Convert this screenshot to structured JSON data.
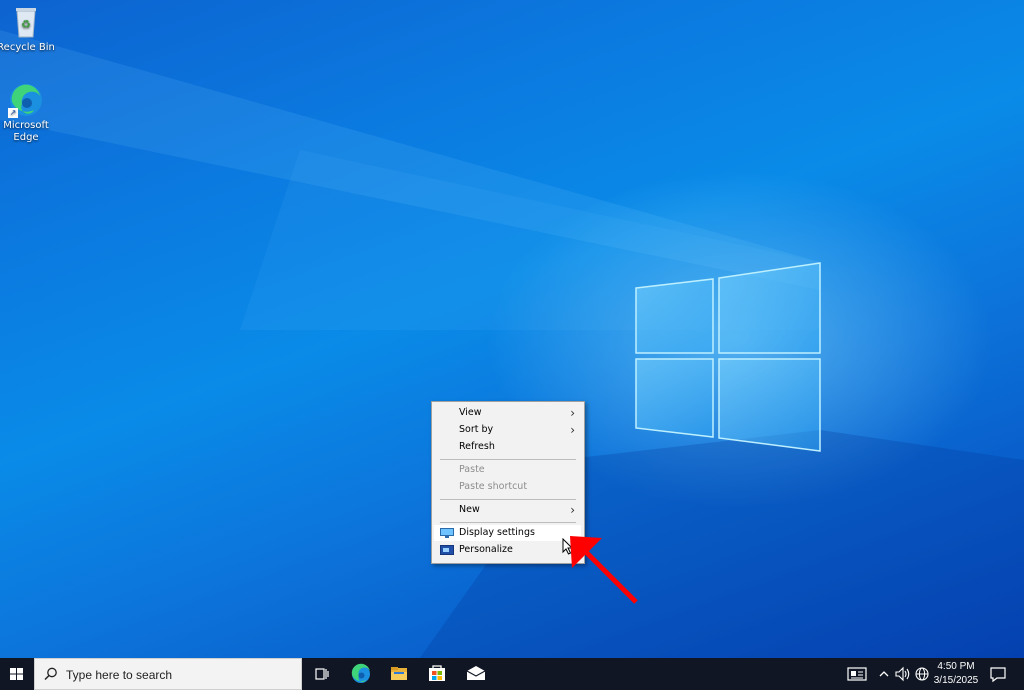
{
  "desktop": {
    "icons": [
      {
        "label": "Recycle Bin",
        "icon": "recycle-bin-icon"
      },
      {
        "label": "Microsoft Edge",
        "icon": "edge-icon"
      }
    ]
  },
  "context_menu": {
    "items": [
      {
        "label": "View",
        "submenu": true
      },
      {
        "label": "Sort by",
        "submenu": true
      },
      {
        "label": "Refresh"
      },
      {
        "label": "Paste",
        "disabled": true
      },
      {
        "label": "Paste shortcut",
        "disabled": true
      },
      {
        "label": "New",
        "submenu": true
      },
      {
        "label": "Display settings",
        "icon": "display-settings-icon"
      },
      {
        "label": "Personalize",
        "icon": "personalize-icon"
      }
    ],
    "submenu_arrow": "›"
  },
  "annotation": {
    "arrow_color": "#ff0000"
  },
  "taskbar": {
    "search_placeholder": "Type here to search",
    "pinned": [
      "task-view-icon",
      "edge-icon",
      "file-explorer-icon",
      "microsoft-store-icon",
      "mail-icon"
    ],
    "tray_icons": [
      "news-icon",
      "chevron-up-icon",
      "volume-icon",
      "globe-icon"
    ],
    "time": "4:50 PM",
    "date": "3/15/2025"
  },
  "colors": {
    "taskbar": "#101623",
    "accent": "#0a78d7",
    "menu_bg": "#f2f2f2"
  }
}
